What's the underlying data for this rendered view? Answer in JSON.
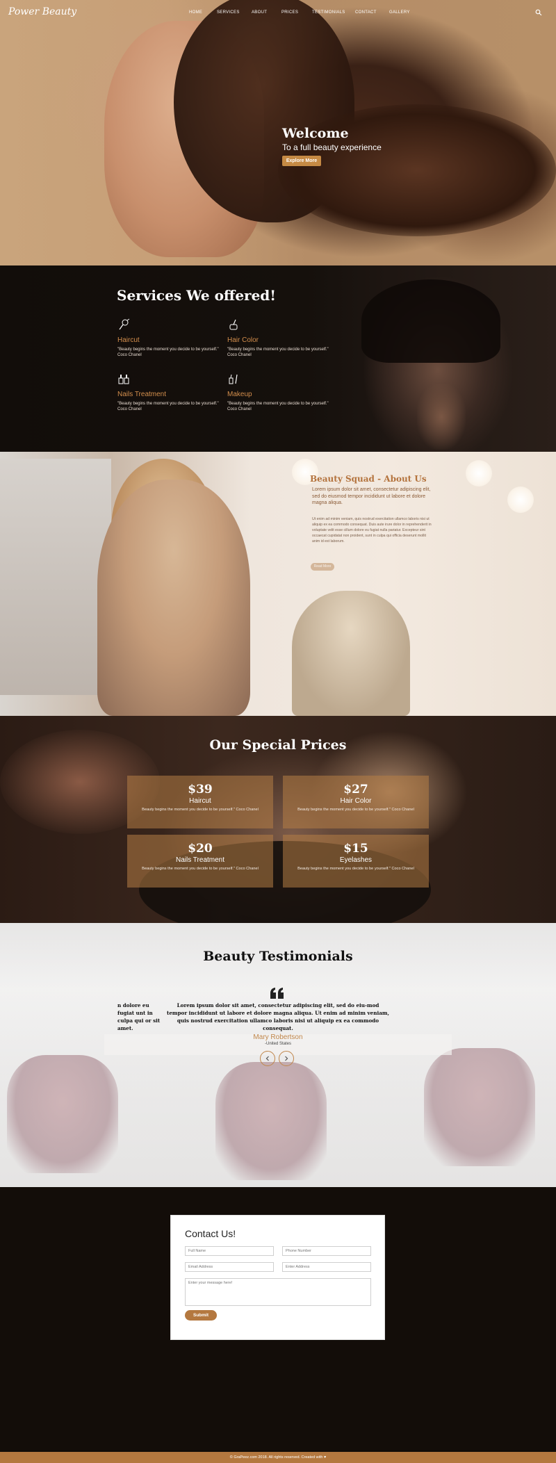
{
  "brand": "Power Beauty",
  "nav": {
    "items": [
      "HOME",
      "SERVICES",
      "ABOUT",
      "PRICES",
      "TESTIMONIALS",
      "CONTACT",
      "GALLERY"
    ],
    "search_icon": "search-icon"
  },
  "hero": {
    "title": "Welcome",
    "subtitle": "To a full beauty experience",
    "button": "Explore More"
  },
  "services": {
    "title": "Services We offered!",
    "items": [
      {
        "name": "Haircut",
        "text": "\"Beauty begins the moment you decide to be yourself.\" Coco Chanel",
        "icon": "hairdryer-icon"
      },
      {
        "name": "Hair Color",
        "text": "\"Beauty begins the moment you decide to be yourself.\" Coco Chanel",
        "icon": "hair-color-icon"
      },
      {
        "name": "Nails Treatment",
        "text": "\"Beauty begins the moment you decide to be yourself.\" Coco Chanel",
        "icon": "nail-polish-icon"
      },
      {
        "name": "Makeup",
        "text": "\"Beauty begins the moment you decide to be yourself.\" Coco Chanel",
        "icon": "makeup-icon"
      }
    ]
  },
  "about": {
    "title": "Beauty Squad - About Us",
    "lead": "Lorem ipsum dolor sit amet, consectetur adipiscing elit, sed do eiusmod tempor incididunt ut labore et dolore magna aliqua.",
    "body": "Ut enim ad minim veniam, quis nostrud exercitation ullamco laboris nisi ut aliquip ex ea commodo consequat. Duis aute irure dolor in reprehenderit in voluptate velit esse cillum dolore eu fugiat nulla pariatur. Excepteur sint occaecat cupidatat non proident, sunt in culpa qui officia deserunt mollit anim id est laborum.",
    "button": "Read More"
  },
  "prices": {
    "title": "Our Special Prices",
    "cards": [
      {
        "price": "$39",
        "name": "Haircut",
        "text": "Beauty begins the moment you decide to be yourself.\" Coco Chanel"
      },
      {
        "price": "$27",
        "name": "Hair Color",
        "text": "Beauty begins the moment you decide to be yourself.\" Coco Chanel"
      },
      {
        "price": "$20",
        "name": "Nails Treatment",
        "text": "Beauty begins the moment you decide to be yourself.\" Coco Chanel"
      },
      {
        "price": "$15",
        "name": "Eyelashes",
        "text": "Beauty begins the moment you decide to be yourself.\" Coco Chanel"
      }
    ]
  },
  "testimonials": {
    "title": "Beauty Testimonials",
    "partial_quote": "n dolore eu fugiat unt in culpa qui or sit amet.",
    "quote": "Lorem ipsum dolor sit amet, consectetur adipiscing elit, sed do eiu-mod tempor incididunt ut labore et dolore magna aliqua. Ut enim ad minim veniam, quis nostrud exercitation ullamco laboris nisi ut aliquip ex ea commodo consequat.",
    "name": "Mary Robertson",
    "location": "-United States"
  },
  "contact": {
    "title": "Contact Us!",
    "full_name_placeholder": "Full Name",
    "phone_placeholder": "Phone Number",
    "email_placeholder": "Email Address",
    "enter_address_placeholder": "Enter Address",
    "message_placeholder": "Enter your message here!",
    "submit": "Submit"
  },
  "footer": {
    "text": "© GraPeez.com 2018. All rights reserved. Created with ♥"
  },
  "colors": {
    "accent": "#c58a44",
    "footer": "#b4783f",
    "dark_bg": "#130d09"
  }
}
